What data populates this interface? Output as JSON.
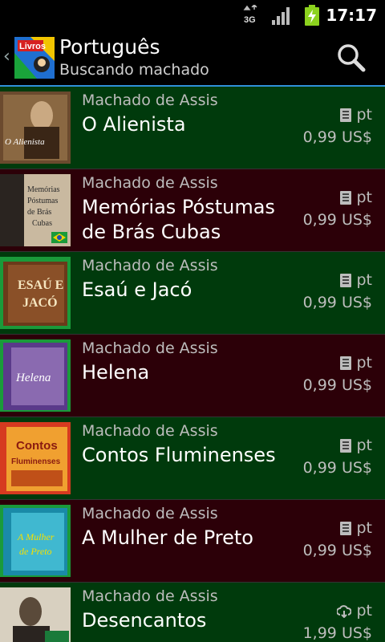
{
  "status": {
    "time": "17:17",
    "network": "3G"
  },
  "header": {
    "title": "Português",
    "subtitle": "Buscando machado",
    "logo_text": "Livros"
  },
  "books": [
    {
      "author": "Machado de Assis",
      "title": "O Alienista",
      "lang": "pt",
      "price": "0,99 US$",
      "cover_text": "O Alienista",
      "bg": "green",
      "icon": "book-icon"
    },
    {
      "author": "Machado de Assis",
      "title": "Memórias Póstumas de Brás Cubas",
      "lang": "pt",
      "price": "0,99 US$",
      "cover_text": "Memórias Póstumas de Brás Cubas",
      "bg": "red",
      "icon": "book-icon"
    },
    {
      "author": "Machado de Assis",
      "title": "Esaú e Jacó",
      "lang": "pt",
      "price": "0,99 US$",
      "cover_text": "Esaú e Jacó",
      "bg": "green",
      "icon": "book-icon"
    },
    {
      "author": "Machado de Assis",
      "title": "Helena",
      "lang": "pt",
      "price": "0,99 US$",
      "cover_text": "Helena",
      "bg": "red",
      "icon": "book-icon"
    },
    {
      "author": "Machado de Assis",
      "title": "Contos Fluminenses",
      "lang": "pt",
      "price": "0,99 US$",
      "cover_text": "Contos Fluminenses",
      "bg": "green",
      "icon": "book-icon"
    },
    {
      "author": "Machado de Assis",
      "title": "A Mulher de Preto",
      "lang": "pt",
      "price": "0,99 US$",
      "cover_text": "A Mulher de Preto",
      "bg": "red",
      "icon": "book-icon"
    },
    {
      "author": "Machado de Assis",
      "title": "Desencantos",
      "lang": "pt",
      "price": "1,99 US$",
      "cover_text": "",
      "bg": "green",
      "icon": "cloud-download-icon"
    }
  ],
  "colors": {
    "green_row": "#003a0c",
    "red_row": "#2c0008",
    "accent": "#2f90d8"
  }
}
